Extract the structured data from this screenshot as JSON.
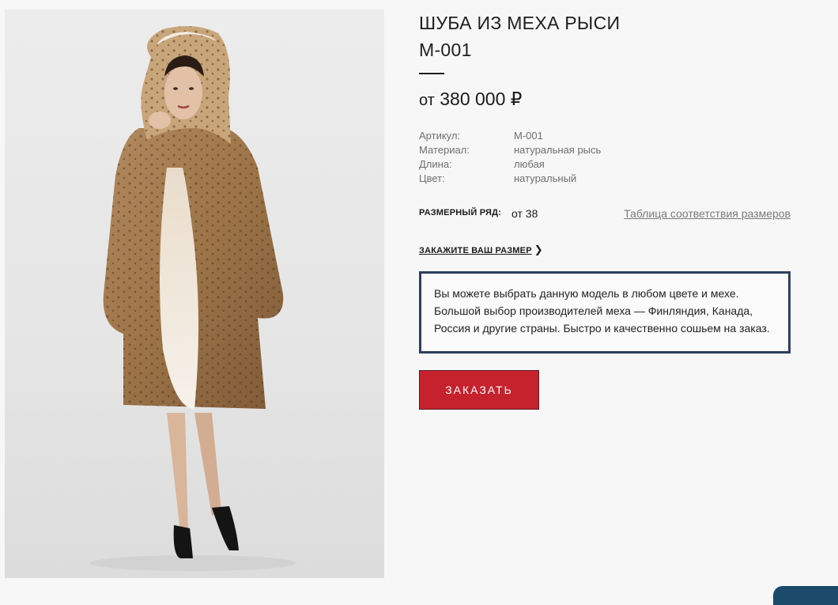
{
  "product": {
    "title_line1": "ШУБА ИЗ МЕХА РЫСИ",
    "title_line2": "М-001",
    "price_prefix": "от",
    "price_value": "380 000 ₽",
    "image_alt": "Шуба из меха рыси М-001"
  },
  "specs": [
    {
      "label": "Артикул:",
      "value": "М-001"
    },
    {
      "label": "Материал:",
      "value": "натуральная рысь"
    },
    {
      "label": "Длина:",
      "value": "любая"
    },
    {
      "label": "Цвет:",
      "value": "натуральный"
    }
  ],
  "size": {
    "label": "РАЗМЕРНЫЙ РЯД:",
    "value": "от 38",
    "table_link": "Таблица соответствия размеров"
  },
  "order_size_link": "ЗАКАЖИТЕ ВАШ РАЗМЕР",
  "note": {
    "line1": "Вы можете выбрать данную модель в любом цвете и мехе.",
    "line2": "Большой выбор производителей меха — Финляндия, Канада,",
    "line3": "Россия и другие страны. Быстро и качественно сошьем на заказ."
  },
  "order_button": "ЗАКАЗАТЬ",
  "colors": {
    "accent_red": "#c6222e",
    "note_border": "#2d3f5e",
    "background": "#f7f7f7"
  }
}
